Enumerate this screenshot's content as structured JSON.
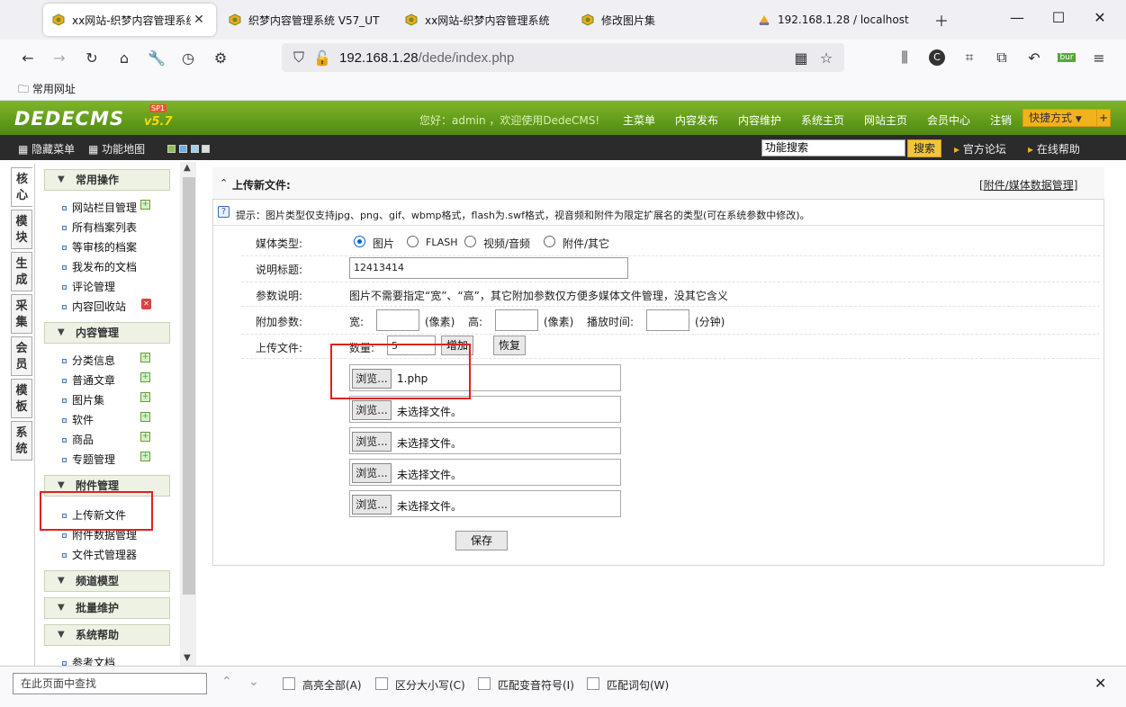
{
  "browser": {
    "tabs": [
      {
        "title": "xx网站-织梦内容管理系统"
      },
      {
        "title": "织梦内容管理系统 V57_UT"
      },
      {
        "title": "xx网站-织梦内容管理系统"
      },
      {
        "title": "修改图片集"
      },
      {
        "title": "192.168.1.28 / localhost"
      }
    ],
    "url_host": "192.168.1.28",
    "url_path": "/dede/index.php",
    "bookmark": "常用网址",
    "ext_badge": "bur"
  },
  "cms": {
    "logo": "DEDECMS",
    "version": "v5.7",
    "badge": "SP1",
    "welcome": "您好：admin ，欢迎使用DedeCMS!",
    "topnav": [
      "主菜单",
      "内容发布",
      "内容维护",
      "系统主页",
      "网站主页",
      "会员中心",
      "注销"
    ],
    "quick": "快捷方式",
    "hide_menu": "隐藏菜单",
    "func_map": "功能地图",
    "search_value": "功能搜索",
    "search_btn": "搜索",
    "forum": "官方论坛",
    "help": "在线帮助"
  },
  "sidetabs": [
    "核心",
    "模块",
    "生成",
    "采集",
    "会员",
    "模板",
    "系统"
  ],
  "menu": {
    "group1": "常用操作",
    "group1_items": [
      "网站栏目管理",
      "所有档案列表",
      "等审核的档案",
      "我发布的文档",
      "评论管理",
      "内容回收站"
    ],
    "group2": "内容管理",
    "group2_items": [
      "分类信息",
      "普通文章",
      "图片集",
      "软件",
      "商品",
      "专题管理"
    ],
    "group3": "附件管理",
    "group3_items": [
      "上传新文件",
      "附件数据管理",
      "文件式管理器"
    ],
    "group4": "频道模型",
    "group5": "批量维护",
    "group6": "系统帮助",
    "group6_items": [
      "参考文档"
    ]
  },
  "panel": {
    "title": "上传新文件:",
    "manage_link": "[附件/媒体数据管理]",
    "tip": "提示：图片类型仅支持jpg、png、gif、wbmp格式，flash为.swf格式，视音频和附件为限定扩展名的类型(可在系统参数中修改)。",
    "media_label": "媒体类型:",
    "media_options": [
      "图片",
      "FLASH",
      "视频/音频",
      "附件/其它"
    ],
    "title_label": "说明标题:",
    "title_value": "12413414",
    "param_label": "参数说明:",
    "param_text": "图片不需要指定“宽”、“高”，其它附加参数仅方便多媒体文件管理，没其它含义",
    "extra_label": "附加参数:",
    "width_label": "宽:",
    "px1": "(像素)",
    "height_label": "高:",
    "px2": "(像素)",
    "play_label": "播放时间:",
    "minutes": "(分钟)",
    "upload_label": "上传文件:",
    "count_label": "数量:",
    "count_value": "5",
    "add_btn": "增加",
    "restore_btn": "恢复",
    "browse": "浏览...",
    "files": [
      "1.php",
      "未选择文件。",
      "未选择文件。",
      "未选择文件。",
      "未选择文件。"
    ],
    "save_btn": "保存"
  },
  "findbar": {
    "placeholder": "在此页面中查找",
    "highlight": "高亮全部(A)",
    "case": "区分大小写(C)",
    "diacritics": "匹配变音符号(I)",
    "whole": "匹配词句(W)"
  }
}
